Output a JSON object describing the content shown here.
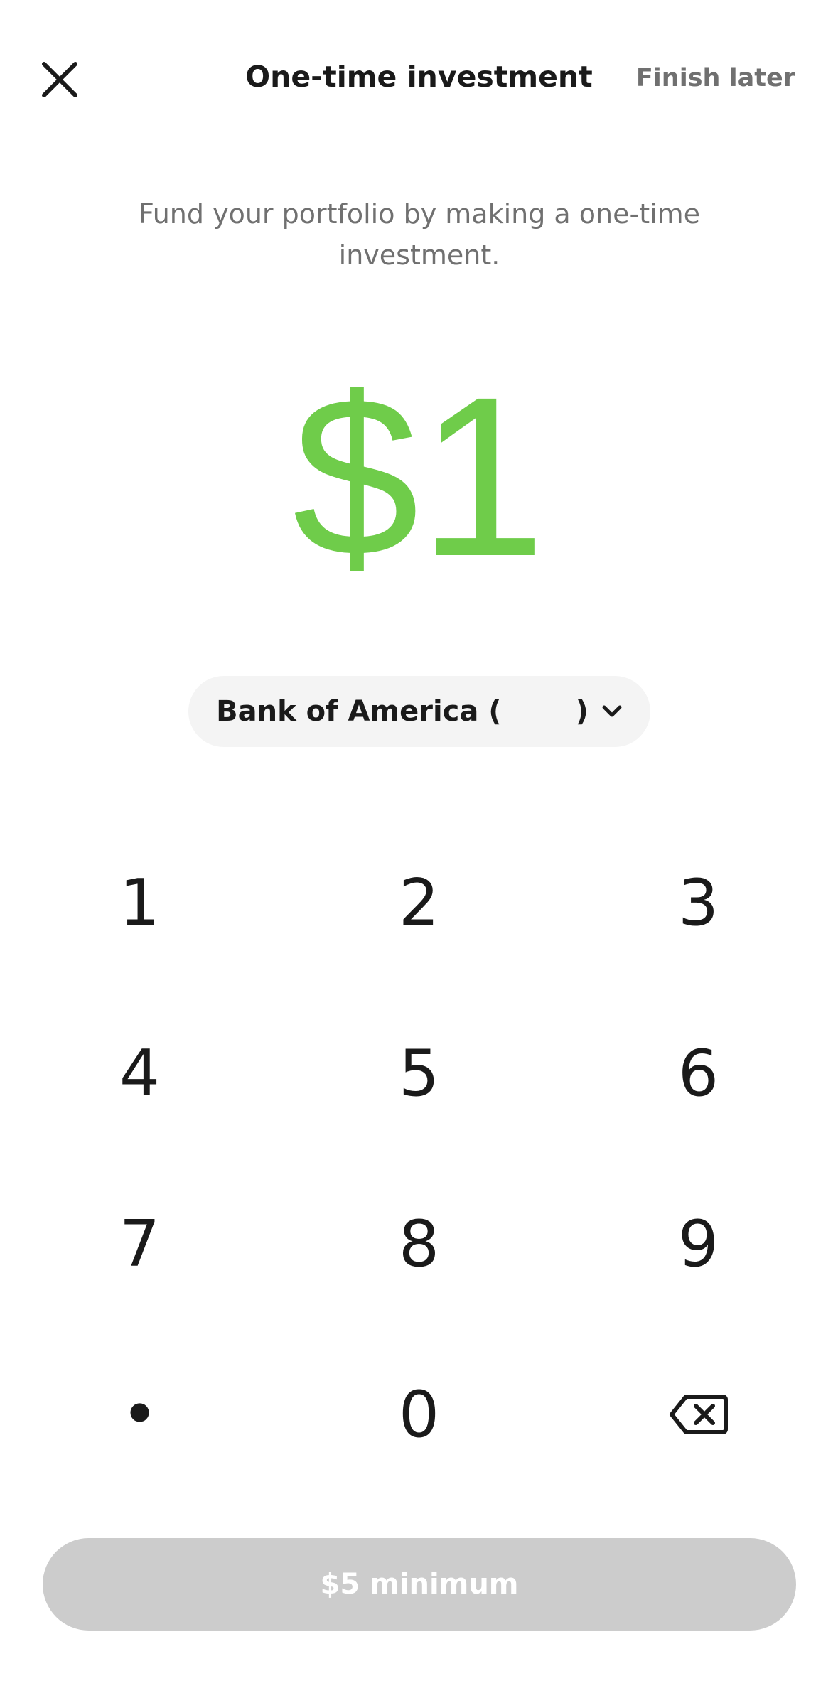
{
  "header": {
    "title": "One-time investment",
    "finish_later_label": "Finish later"
  },
  "subtitle": "Fund your portfolio by making a one-time investment.",
  "amount": {
    "display": "$1",
    "color": "#6fcc4a"
  },
  "bank": {
    "label_prefix": "Bank of America (",
    "label_suffix": ")",
    "dropdown_icon": "chevron-down-icon"
  },
  "keypad": {
    "keys": [
      "1",
      "2",
      "3",
      "4",
      "5",
      "6",
      "7",
      "8",
      "9",
      "•",
      "0"
    ],
    "delete_icon": "backspace-icon"
  },
  "cta": {
    "label": "$5 minimum",
    "background": "#cccccc"
  }
}
